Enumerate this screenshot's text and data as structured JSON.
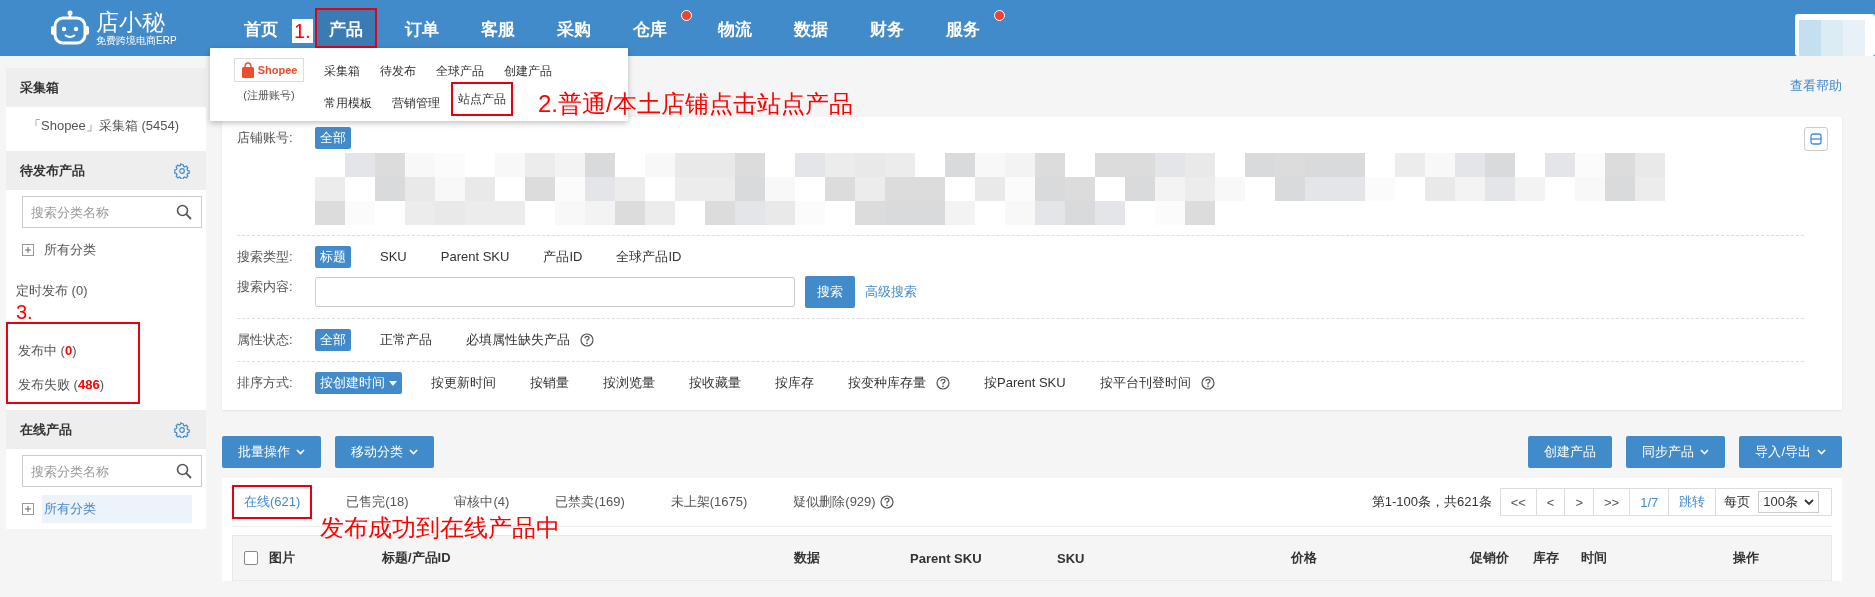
{
  "logo": {
    "name": "店小秘",
    "tagline": "免费跨境电商ERP"
  },
  "nav": [
    {
      "label": "首页",
      "selected": false,
      "highlighted": false,
      "badge": false
    },
    {
      "label": "产品",
      "selected": true,
      "highlighted": true,
      "badge": false
    },
    {
      "label": "订单",
      "selected": false,
      "highlighted": false,
      "badge": false
    },
    {
      "label": "客服",
      "selected": false,
      "highlighted": false,
      "badge": false
    },
    {
      "label": "采购",
      "selected": false,
      "highlighted": false,
      "badge": false
    },
    {
      "label": "仓库",
      "selected": false,
      "highlighted": false,
      "badge": true
    },
    {
      "label": "物流",
      "selected": false,
      "highlighted": false,
      "badge": false
    },
    {
      "label": "数据",
      "selected": false,
      "highlighted": false,
      "badge": false
    },
    {
      "label": "财务",
      "selected": false,
      "highlighted": false,
      "badge": false
    },
    {
      "label": "服务",
      "selected": false,
      "highlighted": false,
      "badge": true
    }
  ],
  "product_menu": {
    "platform": "Shopee",
    "platform_note": "(注册账号)",
    "rows": [
      [
        {
          "label": "采集箱",
          "highlighted": false
        },
        {
          "label": "待发布",
          "highlighted": false
        },
        {
          "label": "全球产品",
          "highlighted": false
        },
        {
          "label": "创建产品",
          "highlighted": false
        }
      ],
      [
        {
          "label": "常用模板",
          "highlighted": false
        },
        {
          "label": "营销管理",
          "highlighted": false
        },
        {
          "label": "站点产品",
          "highlighted": true
        }
      ]
    ]
  },
  "annotations": {
    "nav": "1.",
    "menu": "2.普通/本土店铺点击站点产品",
    "sidebar": "3.",
    "tabs": "发布成功到在线产品中"
  },
  "sidebar": {
    "sections": [
      {
        "title": "采集箱",
        "settings": false,
        "links": [
          "「Shopee」采集箱 (5454)"
        ]
      },
      {
        "title": "待发布产品",
        "settings": true,
        "search_placeholder": "搜索分类名称",
        "tree": {
          "label": "所有分类",
          "selected": false
        },
        "statuses": [
          {
            "label": "定时发布 (0)",
            "highlighted": false
          },
          {
            "label": "发布中 (**0**)",
            "highlighted": true
          },
          {
            "label": "发布失败 (**486**)",
            "highlighted": true
          }
        ]
      },
      {
        "title": "在线产品",
        "settings": true,
        "search_placeholder": "搜索分类名称",
        "tree": {
          "label": "所有分类",
          "selected": true
        }
      }
    ]
  },
  "help_link": "查看帮助",
  "filter_groups": [
    [
      {
        "kind": "chips",
        "label": "店铺账号:",
        "redacted": true,
        "options": [
          {
            "label": "全部",
            "selected": true
          }
        ]
      }
    ],
    [
      {
        "kind": "chips",
        "label": "搜索类型:",
        "options": [
          {
            "label": "标题",
            "selected": true
          },
          {
            "label": "SKU",
            "selected": false
          },
          {
            "label": "Parent SKU",
            "selected": false
          },
          {
            "label": "产品ID",
            "selected": false
          },
          {
            "label": "全球产品ID",
            "selected": false
          }
        ]
      },
      {
        "kind": "search",
        "label": "搜索内容:",
        "button": "搜索",
        "link": "高级搜索"
      }
    ],
    [
      {
        "kind": "chips",
        "label": "属性状态:",
        "options": [
          {
            "label": "全部",
            "selected": true
          },
          {
            "label": "正常产品",
            "selected": false
          },
          {
            "label": "必填属性缺失产品",
            "selected": false,
            "help": true
          }
        ]
      }
    ],
    [
      {
        "kind": "chips",
        "label": "排序方式:",
        "options": [
          {
            "label": "按创建时间",
            "selected": true,
            "dropdown": true
          },
          {
            "label": "按更新时间",
            "selected": false
          },
          {
            "label": "按销量",
            "selected": false
          },
          {
            "label": "按浏览量",
            "selected": false
          },
          {
            "label": "按收藏量",
            "selected": false
          },
          {
            "label": "按库存",
            "selected": false
          },
          {
            "label": "按变种库存量",
            "selected": false,
            "help": true
          },
          {
            "label": "按Parent SKU",
            "selected": false
          },
          {
            "label": "按平台刊登时间",
            "selected": false,
            "help": true
          }
        ]
      }
    ]
  ],
  "left_actions": [
    {
      "label": "批量操作",
      "dropdown": true
    },
    {
      "label": "移动分类",
      "dropdown": true
    }
  ],
  "right_actions": [
    {
      "label": "创建产品",
      "dropdown": false
    },
    {
      "label": "同步产品",
      "dropdown": true
    },
    {
      "label": "导入/导出",
      "dropdown": true
    }
  ],
  "tabs": [
    {
      "label": "在线(621)",
      "selected": true,
      "highlighted": true
    },
    {
      "label": "已售完(18)",
      "selected": false,
      "highlighted": false
    },
    {
      "label": "审核中(4)",
      "selected": false,
      "highlighted": false
    },
    {
      "label": "已禁卖(169)",
      "selected": false,
      "highlighted": false
    },
    {
      "label": "未上架(1675)",
      "selected": false,
      "highlighted": false
    },
    {
      "label": "疑似删除(929)",
      "selected": false,
      "highlighted": false,
      "help": true
    }
  ],
  "pagination": {
    "summary": "第1-100条，共621条",
    "buttons": [
      "<<",
      "<",
      ">",
      ">>"
    ],
    "page": "1/7",
    "jump": "跳转",
    "per_page_label": "每页",
    "per_page": "100条"
  },
  "table": {
    "select_all_checked": false,
    "columns": [
      "图片",
      "标题/产品ID",
      "数据",
      "Parent SKU",
      "SKU",
      "价格",
      "促销价",
      "库存",
      "时间",
      "操作"
    ]
  }
}
